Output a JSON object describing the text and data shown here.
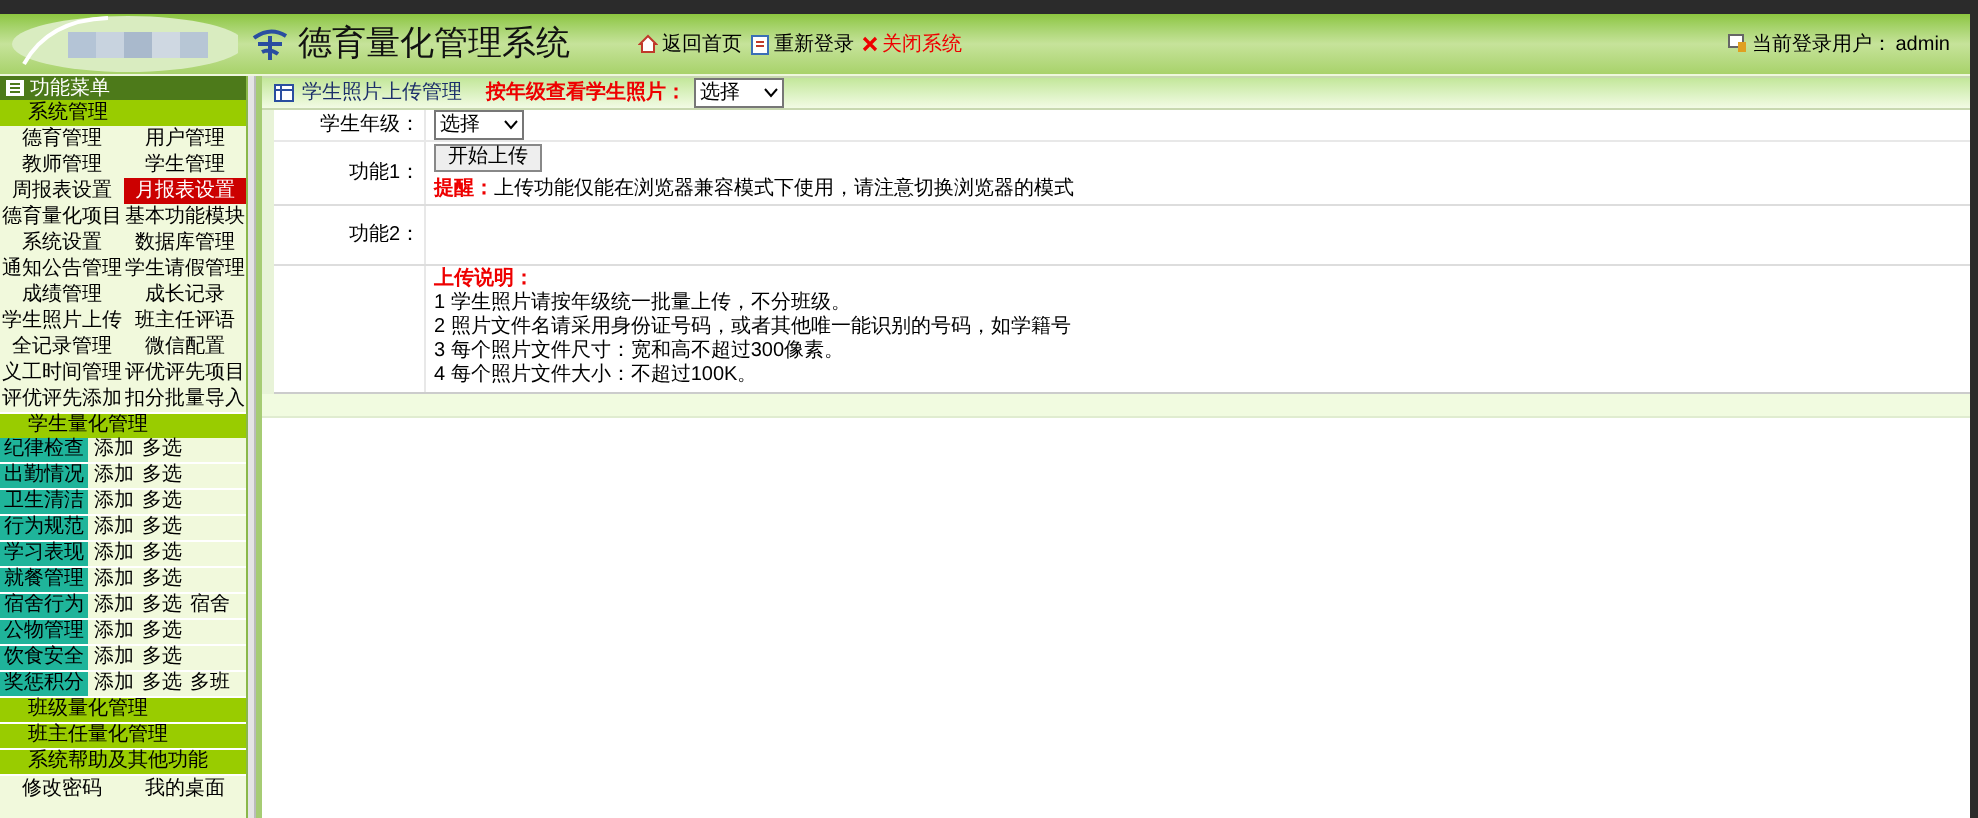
{
  "header": {
    "title": "德育量化管理系统",
    "nav": [
      {
        "kind": "home",
        "label": "返回首页"
      },
      {
        "kind": "login",
        "label": "重新登录"
      },
      {
        "kind": "close",
        "label": "关闭系统"
      }
    ],
    "user_label": "当前登录用户：",
    "user": "admin"
  },
  "sidebar": {
    "title": "功能菜单",
    "system": {
      "title": "系统管理",
      "items": [
        {
          "label": "德育管理",
          "selected": false
        },
        {
          "label": "用户管理",
          "selected": false
        },
        {
          "label": "教师管理",
          "selected": false
        },
        {
          "label": "学生管理",
          "selected": false
        },
        {
          "label": "周报表设置",
          "selected": false
        },
        {
          "label": "月报表设置",
          "selected": true
        },
        {
          "label": "德育量化项目",
          "selected": false
        },
        {
          "label": "基本功能模块",
          "selected": false
        },
        {
          "label": "系统设置",
          "selected": false
        },
        {
          "label": "数据库管理",
          "selected": false
        },
        {
          "label": "通知公告管理",
          "selected": false
        },
        {
          "label": "学生请假管理",
          "selected": false
        },
        {
          "label": "成绩管理",
          "selected": false
        },
        {
          "label": "成长记录",
          "selected": false
        },
        {
          "label": "学生照片上传",
          "selected": false
        },
        {
          "label": "班主任评语",
          "selected": false
        },
        {
          "label": "全记录管理",
          "selected": false
        },
        {
          "label": "微信配置",
          "selected": false
        },
        {
          "label": "义工时间管理",
          "selected": false
        },
        {
          "label": "评优评先项目",
          "selected": false
        },
        {
          "label": "评优评先添加",
          "selected": false
        },
        {
          "label": "扣分批量导入",
          "selected": false
        }
      ]
    },
    "student": {
      "title": "学生量化管理",
      "rows": [
        {
          "label": "纪律检查",
          "links": [
            "添加",
            "多选"
          ]
        },
        {
          "label": "出勤情况",
          "links": [
            "添加",
            "多选"
          ]
        },
        {
          "label": "卫生清洁",
          "links": [
            "添加",
            "多选"
          ]
        },
        {
          "label": "行为规范",
          "links": [
            "添加",
            "多选"
          ]
        },
        {
          "label": "学习表现",
          "links": [
            "添加",
            "多选"
          ]
        },
        {
          "label": "就餐管理",
          "links": [
            "添加",
            "多选"
          ]
        },
        {
          "label": "宿舍行为",
          "links": [
            "添加",
            "多选",
            "宿舍"
          ]
        },
        {
          "label": "公物管理",
          "links": [
            "添加",
            "多选"
          ]
        },
        {
          "label": "饮食安全",
          "links": [
            "添加",
            "多选"
          ]
        },
        {
          "label": "奖惩积分",
          "links": [
            "添加",
            "多选",
            "多班"
          ]
        }
      ]
    },
    "sections": [
      "班级量化管理",
      "班主任量化管理",
      "系统帮助及其他功能"
    ],
    "footer_links": [
      "修改密码",
      "我的桌面"
    ]
  },
  "panel": {
    "title": "学生照片上传管理",
    "filter_label": "按年级查看学生照片：",
    "filter_value": "选择",
    "grade_label": "学生年级：",
    "grade_value": "选择",
    "func1_label": "功能1：",
    "upload_button": "开始上传",
    "reminder_label": "提醒：",
    "reminder": "上传功能仅能在浏览器兼容模式下使用，请注意切换浏览器的模式",
    "func2_label": "功能2：",
    "notes_title": "上传说明：",
    "notes": [
      "1 学生照片请按年级统一批量上传，不分班级。",
      "2 照片文件名请采用身份证号码，或者其他唯一能识别的号码，如学籍号",
      "3 每个照片文件尺寸：宽和高不超过300像素。",
      "4 每个照片文件大小：不超过100K。"
    ]
  }
}
